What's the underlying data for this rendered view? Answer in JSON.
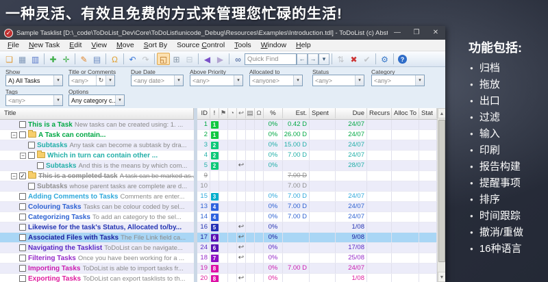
{
  "banner": {
    "title": "一种灵活、有效且免费的方式来管理您忙碌的生活!"
  },
  "window": {
    "title": "Sample Tasklist [D:\\_code\\ToDoList_Dev\\Core\\ToDoList\\unicode_Debug\\Resources\\Examples\\Introduction.tdl] - ToDoList (c) AbstractSp...",
    "minimize": "—",
    "maximize": "❐",
    "close": "✕"
  },
  "menu": {
    "items": [
      {
        "label": "File",
        "mnemonic": 0
      },
      {
        "label": "New Task",
        "mnemonic": 0
      },
      {
        "label": "Edit",
        "mnemonic": 0
      },
      {
        "label": "View",
        "mnemonic": 0
      },
      {
        "label": "Move",
        "mnemonic": 0
      },
      {
        "label": "Sort By",
        "mnemonic": 0
      },
      {
        "label": "Source Control",
        "mnemonic": 7
      },
      {
        "label": "Tools",
        "mnemonic": 0
      },
      {
        "label": "Window",
        "mnemonic": 0
      },
      {
        "label": "Help",
        "mnemonic": 0
      }
    ]
  },
  "toolbar": {
    "quick_find_placeholder": "Quick Find",
    "items": [
      {
        "type": "icon",
        "name": "open-tasklist-icon",
        "glyph": "❏",
        "color": "#E09A35"
      },
      {
        "type": "icon",
        "name": "save-icon",
        "glyph": "▦",
        "color": "#8098B8"
      },
      {
        "type": "icon",
        "name": "save-all-icon",
        "glyph": "▥",
        "color": "#5878C8"
      },
      {
        "type": "sep"
      },
      {
        "type": "icon",
        "name": "new-task-icon",
        "glyph": "✚",
        "color": "#3FAE49"
      },
      {
        "type": "icon",
        "name": "new-subtask-icon",
        "glyph": "✛",
        "color": "#3FAE49"
      },
      {
        "type": "sep"
      },
      {
        "type": "icon",
        "name": "edit-task-icon",
        "glyph": "✎",
        "color": "#E0862E"
      },
      {
        "type": "icon",
        "name": "edit-comments-icon",
        "glyph": "▤",
        "color": "#6888C0"
      },
      {
        "type": "sep"
      },
      {
        "type": "icon",
        "name": "reminder-bell-icon",
        "glyph": "Ω",
        "color": "#E0A030"
      },
      {
        "type": "sep"
      },
      {
        "type": "icon",
        "name": "undo-icon",
        "glyph": "↶",
        "color": "#3B78D8"
      },
      {
        "type": "icon",
        "name": "redo-icon",
        "glyph": "↷",
        "color": "#888888",
        "disabled": true
      },
      {
        "type": "sep"
      },
      {
        "type": "icon",
        "name": "maximize-tasklist-icon",
        "glyph": "◱",
        "color": "#B06818",
        "active": true
      },
      {
        "type": "icon",
        "name": "expand-tasks-icon",
        "glyph": "⊞",
        "color": "#8898A8"
      },
      {
        "type": "icon",
        "name": "collapse-tasks-icon",
        "glyph": "⊟",
        "color": "#8898A8",
        "disabled": true
      },
      {
        "type": "sep"
      },
      {
        "type": "icon",
        "name": "previous-task-icon",
        "glyph": "◀",
        "color": "#7A50C8"
      },
      {
        "type": "icon",
        "name": "next-task-icon",
        "glyph": "▶",
        "color": "#B4A6D2"
      },
      {
        "type": "sep"
      },
      {
        "type": "icon",
        "name": "find-tasks-icon",
        "glyph": "∞",
        "color": "#33518F"
      },
      {
        "type": "quickfind"
      },
      {
        "type": "sep"
      },
      {
        "type": "icon",
        "name": "sort-icon",
        "glyph": "⇅",
        "color": "#909090",
        "disabled": true
      },
      {
        "type": "icon",
        "name": "delete-task-icon",
        "glyph": "✖",
        "color": "#CC3333"
      },
      {
        "type": "icon",
        "name": "spellcheck-icon",
        "glyph": "✔",
        "color": "#909090",
        "disabled": true
      },
      {
        "type": "sep"
      },
      {
        "type": "icon",
        "name": "preferences-icon",
        "glyph": "⚙",
        "color": "#3878C8"
      },
      {
        "type": "sep"
      },
      {
        "type": "icon",
        "name": "help-icon",
        "glyph": "?",
        "color": "#FFFFFF",
        "help": true
      }
    ],
    "quickfind_prev": "←",
    "quickfind_next": "→",
    "quickfind_drop": "▾"
  },
  "filters": {
    "row1": [
      {
        "name": "show",
        "label": "Show",
        "value": "A)  All Tasks",
        "muted": false
      },
      {
        "name": "title-or-comments",
        "label": "Title or Comments",
        "value": "<any>",
        "muted": true,
        "has_button": true,
        "button_glyph": "↻"
      },
      {
        "name": "due-date",
        "label": "Due Date",
        "value": "<any date>",
        "muted": true
      },
      {
        "name": "above-priority",
        "label": "Above Priority",
        "value": "<any>",
        "muted": true
      },
      {
        "name": "allocated-to",
        "label": "Allocated to",
        "value": "<anyone>",
        "muted": true
      },
      {
        "name": "status",
        "label": "Status",
        "value": "<any>",
        "muted": true
      },
      {
        "name": "category",
        "label": "Category",
        "value": "<any>",
        "muted": true
      }
    ],
    "row2": [
      {
        "name": "tags",
        "label": "Tags",
        "value": "<any>",
        "muted": true
      },
      {
        "name": "options",
        "label": "Options",
        "value": "Any category c...",
        "muted": false
      }
    ]
  },
  "table": {
    "left_header": "Title",
    "headers": {
      "id": "ID",
      "priority": "!",
      "percent": "%",
      "est": "Est.",
      "spent": "Spent",
      "due": "Due",
      "recurs": "Recurs",
      "alloc_to": "Alloc To",
      "status": "Stat"
    },
    "icon_columns": [
      {
        "name": "flag-icon",
        "glyph": "⚑"
      },
      {
        "name": "clock-icon",
        "glyph": "◔"
      },
      {
        "name": "recurrence-icon",
        "glyph": "↩"
      },
      {
        "name": "file-link-icon",
        "glyph": "▤"
      },
      {
        "name": "reminder-bell-icon",
        "glyph": "Ω"
      }
    ],
    "rows": [
      {
        "id": "1",
        "priority": "1",
        "priority_color": "#10C840",
        "title": "This is a Task",
        "comment": "New tasks can be created using:  1. ...",
        "percent": "0%",
        "est": "0.42 D",
        "spent": "",
        "due": "24/07",
        "color": "#00A844",
        "indent": 0,
        "is_parent": false,
        "has_folder": false,
        "checked": false,
        "completed": false,
        "selected": false,
        "recur_icon": false
      },
      {
        "id": "2",
        "priority": "1",
        "priority_color": "#10C840",
        "title": "A Task can contain...",
        "comment": "",
        "percent": "0%",
        "est": "26.00 D",
        "spent": "",
        "due": "24/07",
        "color": "#00A844",
        "indent": 0,
        "is_parent": true,
        "has_folder": true,
        "checked": false,
        "completed": false,
        "selected": false,
        "recur_icon": false
      },
      {
        "id": "3",
        "priority": "2",
        "priority_color": "#0DC878",
        "title": "Subtasks",
        "comment": "Any task can become a subtask by dra...",
        "percent": "0%",
        "est": "15.00 D",
        "spent": "",
        "due": "24/07",
        "color": "#22AFA8",
        "indent": 1,
        "is_parent": false,
        "has_folder": false,
        "checked": false,
        "completed": false,
        "selected": false,
        "recur_icon": false
      },
      {
        "id": "4",
        "priority": "2",
        "priority_color": "#0DC878",
        "title": "Which in turn can contain other ...",
        "comment": "",
        "percent": "0%",
        "est": "7.00 D",
        "spent": "",
        "due": "24/07",
        "color": "#22AFA8",
        "indent": 1,
        "is_parent": true,
        "has_folder": true,
        "checked": false,
        "completed": false,
        "selected": false,
        "recur_icon": false
      },
      {
        "id": "5",
        "priority": "2",
        "priority_color": "#0DC878",
        "title": "Subtasks",
        "comment": "And this is the means by which com...",
        "percent": "0%",
        "est": "",
        "spent": "",
        "due": "28/07",
        "color": "#22AFA8",
        "indent": 2,
        "is_parent": false,
        "has_folder": false,
        "checked": false,
        "completed": false,
        "selected": false,
        "recur_icon": true
      },
      {
        "id": "9",
        "priority": "",
        "priority_color": "",
        "title": "This is a completed task",
        "comment": "A task can be marked as...",
        "percent": "",
        "est": "7.00 D",
        "spent": "",
        "due": "",
        "color": "#909090",
        "indent": 0,
        "is_parent": true,
        "has_folder": true,
        "checked": true,
        "completed": true,
        "selected": false,
        "recur_icon": false
      },
      {
        "id": "10",
        "priority": "",
        "priority_color": "",
        "title": "Subtasks",
        "comment": "whose parent tasks are complete are d...",
        "percent": "",
        "est": "7.00 D",
        "spent": "",
        "due": "",
        "color": "#909090",
        "indent": 1,
        "is_parent": false,
        "has_folder": false,
        "checked": false,
        "completed": false,
        "selected": false,
        "recur_icon": false
      },
      {
        "id": "15",
        "priority": "3",
        "priority_color": "#00AECC",
        "title": "Adding Comments to Tasks",
        "comment": "Comments are enter...",
        "percent": "0%",
        "est": "7.00 D",
        "spent": "",
        "due": "24/07",
        "color": "#2FA8DC",
        "indent": 0,
        "is_parent": false,
        "has_folder": false,
        "checked": false,
        "completed": false,
        "selected": false,
        "recur_icon": false
      },
      {
        "id": "13",
        "priority": "4",
        "priority_color": "#2E62DE",
        "title": "Colouring Tasks",
        "comment": "Tasks can be colour coded by sel...",
        "percent": "0%",
        "est": "7.00 D",
        "spent": "",
        "due": "24/07",
        "color": "#2E62D2",
        "indent": 0,
        "is_parent": false,
        "has_folder": false,
        "checked": false,
        "completed": false,
        "selected": false,
        "recur_icon": false
      },
      {
        "id": "14",
        "priority": "4",
        "priority_color": "#2E62DE",
        "title": "Categorizing Tasks",
        "comment": "To add an category to the sel...",
        "percent": "0%",
        "est": "7.00 D",
        "spent": "",
        "due": "24/07",
        "color": "#2E62D2",
        "indent": 0,
        "is_parent": false,
        "has_folder": false,
        "checked": false,
        "completed": false,
        "selected": false,
        "recur_icon": false
      },
      {
        "id": "16",
        "priority": "5",
        "priority_color": "#2430B6",
        "title": "Likewise for the task's Status, Allocated to/by...",
        "comment": "",
        "percent": "0%",
        "est": "",
        "spent": "",
        "due": "1/08",
        "color": "#2434B2",
        "indent": 0,
        "is_parent": false,
        "has_folder": false,
        "checked": false,
        "completed": false,
        "selected": false,
        "recur_icon": true
      },
      {
        "id": "17",
        "priority": "6",
        "priority_color": "#5A10B4",
        "title": "Associated Files with Tasks",
        "comment": "The File Link field ca...",
        "percent": "0%",
        "est": "",
        "spent": "",
        "due": "9/08",
        "color": "#1A20A0",
        "indent": 0,
        "is_parent": false,
        "has_folder": false,
        "checked": false,
        "completed": false,
        "selected": true,
        "recur_icon": true
      },
      {
        "id": "24",
        "priority": "6",
        "priority_color": "#5A10B4",
        "title": "Navigating the Tasklist",
        "comment": "ToDoList can be navigate...",
        "percent": "0%",
        "est": "",
        "spent": "",
        "due": "17/08",
        "color": "#5A28C4",
        "indent": 0,
        "is_parent": false,
        "has_folder": false,
        "checked": false,
        "completed": false,
        "selected": false,
        "recur_icon": true
      },
      {
        "id": "18",
        "priority": "7",
        "priority_color": "#9012C4",
        "title": "Filtering Tasks",
        "comment": "Once you have been working for a ...",
        "percent": "0%",
        "est": "",
        "spent": "",
        "due": "25/08",
        "color": "#9428C8",
        "indent": 0,
        "is_parent": false,
        "has_folder": false,
        "checked": false,
        "completed": false,
        "selected": false,
        "recur_icon": true
      },
      {
        "id": "19",
        "priority": "8",
        "priority_color": "#DE10A6",
        "title": "Importing Tasks",
        "comment": "ToDoList is able to import tasks fr...",
        "percent": "0%",
        "est": "7.00 D",
        "spent": "",
        "due": "24/07",
        "color": "#CC1CB0",
        "indent": 0,
        "is_parent": false,
        "has_folder": false,
        "checked": false,
        "completed": false,
        "selected": false,
        "recur_icon": false
      },
      {
        "id": "20",
        "priority": "8",
        "priority_color": "#DE10A6",
        "title": "Exporting Tasks",
        "comment": "ToDoList can export tasklists to th...",
        "percent": "0%",
        "est": "",
        "spent": "",
        "due": "1/08",
        "color": "#DE1C9E",
        "indent": 0,
        "is_parent": false,
        "has_folder": false,
        "checked": false,
        "completed": false,
        "selected": false,
        "recur_icon": true
      }
    ]
  },
  "sidebar": {
    "heading": "功能包括:",
    "features": [
      "归档",
      "拖放",
      "出口",
      "过滤",
      "输入",
      "印刷",
      "报告构建",
      "提醒事项",
      "排序",
      "时间跟踪",
      "撤消/重做",
      "16种语言"
    ]
  },
  "colors": {
    "selection": "#A9D6F5",
    "row_alt": "#ECECF9",
    "titlebar": "#3C4049",
    "comment_text": "#8A8A8A"
  }
}
